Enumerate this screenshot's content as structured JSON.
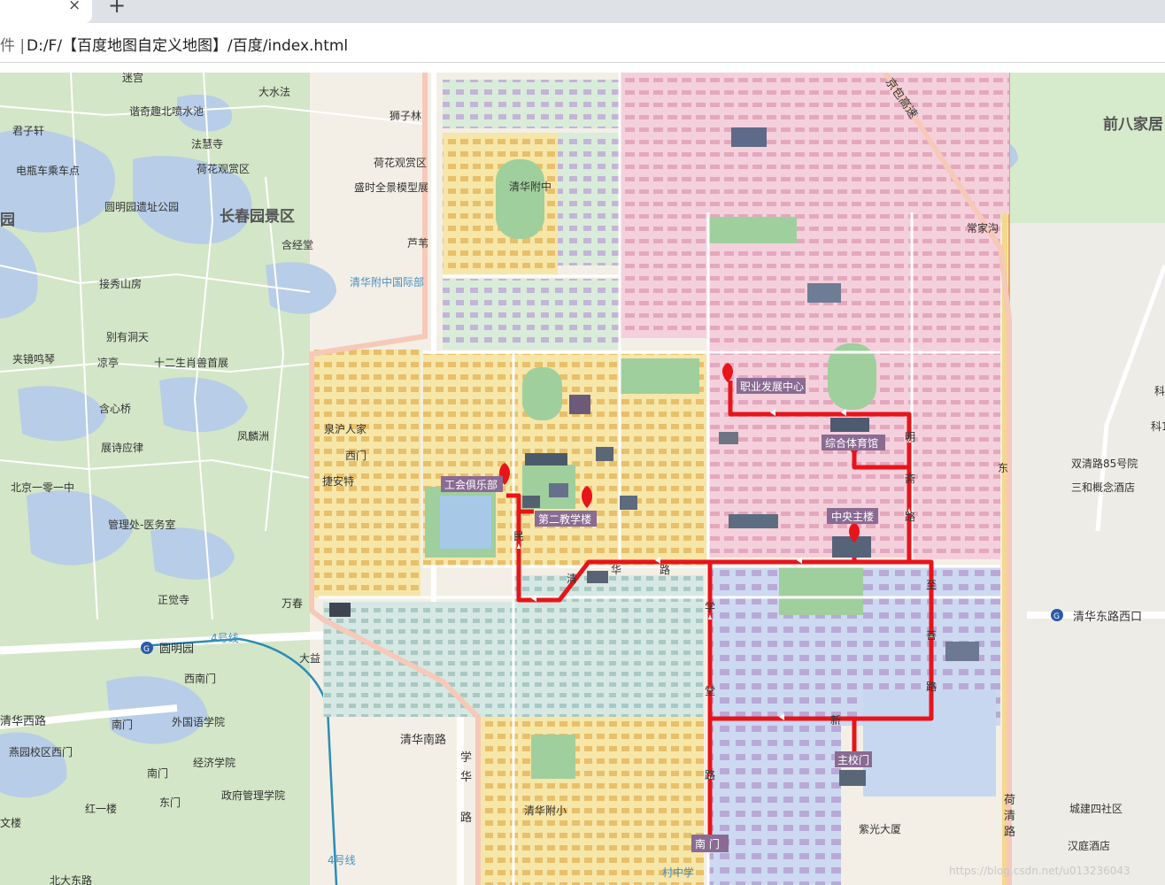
{
  "browser": {
    "tab_close_glyph": "×",
    "new_tab_glyph": "+",
    "url_prefix": "件 |",
    "url": "D:/F/【百度地图自定义地图】/百度/index.html"
  },
  "map": {
    "places": {
      "migong": "迷宫",
      "dashuifa": "大水法",
      "xieqiqu": "谐奇趣北喷水池",
      "junzixuan": "君子轩",
      "shizilin": "狮子林",
      "fahuisi": "法慧寺",
      "dianpingche": "电瓶车乘车点",
      "hehuaguanshang1": "荷花观赏区",
      "hehuaguanshang2": "荷花观赏区",
      "yuanmingyuan_park": "圆明园遗址公园",
      "shengshi_moxing": "盛时全景模型展",
      "changchunyuan": "长春园景区",
      "hanjingtang": "含经堂",
      "yuan_left": "园",
      "lufengwu": "芦苇",
      "qinghua_fuzhong_intl": "清华附中国际部",
      "jiexiushan": "接秀山房",
      "bieyoudongtian": "别有洞天",
      "jiajingmingqin": "夹镜鸣琴",
      "liangting": "凉亭",
      "shouzhu": "十二生肖兽首展",
      "hanxinqiao": "含心桥",
      "fenglinzhou": "凤麟洲",
      "zhanshiyingli": "展诗应律",
      "jinghu_renjia": "泉沪人家",
      "ximen": "西门",
      "beijing101": "北京一零一中",
      "jieante": "捷安特",
      "guanlichu": "管理处-医务室",
      "zhengjuesi": "正觉寺",
      "wanchun": "万春",
      "yuanmingyuan_station": "圆明园",
      "xinanmen": "西南门",
      "line4_a": "4号线",
      "line4_b": "4号线",
      "dayi": "大益",
      "qinghua_xilu": "清华西路",
      "waiyu": "外国语学院",
      "nanmen_left": "南门",
      "yanyuan_xixiaoqu": "燕园校区西门",
      "jingji": "经济学院",
      "nanmen_left2": "南门",
      "zhengfu": "政府管理学院",
      "hongyilou": "红一楼",
      "dongmen": "东门",
      "wenjlou": "文楼",
      "bedaozhenglu": "北大东路",
      "qinghua_nanlu": "清华南路",
      "zijin_dasha": "紫光大厦",
      "cunzhong": "村中学",
      "qianbajiacun": "前八家居",
      "jingtong_highway": "京包高速",
      "changjiagou": "常家沟",
      "shuangqinglu85": "双清路85号院",
      "sanhe_hotel": "三和概念酒店",
      "qinghua_donglu_xikou": "清华东路西口",
      "chengjian_sihequ": "城建四社区",
      "hanting": "汉庭酒店",
      "ke_top": "科",
      "ke_mid": "科1",
      "heqinglu": "荷清路",
      "zhixuelu": "至善路",
      "xuetanglu": "学堂路",
      "shuangqinglu": "双清路",
      "tsinghua_fuzhong": "清华附中",
      "luotuotou": "清华附小"
    },
    "markers": {
      "zhiye": "职业发展中心",
      "tiyuguan": "综合体育馆",
      "gonghui": "工会俱乐部",
      "dierjiao": "第二教学楼",
      "zhongyang": "中央主楼",
      "zhuxiaomen": "主校门",
      "nanmen": "南 门"
    },
    "road_glyphs": {
      "qing": "清",
      "hua": "华",
      "lu": "路",
      "xue": "学",
      "tang": "堂",
      "xin": "新",
      "min": "民",
      "zhi": "至",
      "shan": "善",
      "ming": "明",
      "zhai": "斋",
      "he": "荷",
      "qing2": "清",
      "dong": "东"
    },
    "watermark": "https://blog.csdn.net/u013236043"
  }
}
